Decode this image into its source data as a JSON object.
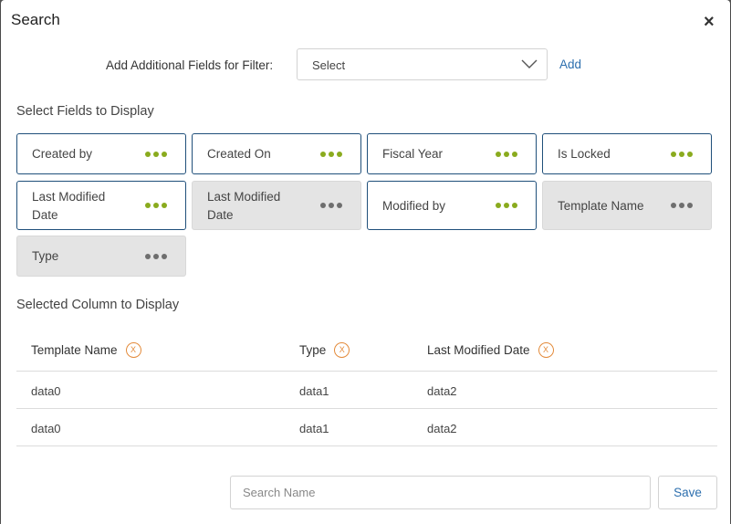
{
  "dialog": {
    "title": "Search",
    "close_icon": "×"
  },
  "filter": {
    "label": "Add Additional Fields for Filter:",
    "select_value": "Select",
    "add_label": "Add"
  },
  "fields_section": {
    "title": "Select Fields to Display"
  },
  "fields": [
    {
      "label": "Created by",
      "state": "active"
    },
    {
      "label": "Created On",
      "state": "active"
    },
    {
      "label": "Fiscal Year",
      "state": "active"
    },
    {
      "label": "Is Locked",
      "state": "active"
    },
    {
      "label": "Last Modified Date",
      "state": "active"
    },
    {
      "label": "Last Modified Date",
      "state": "inactive"
    },
    {
      "label": "Modified by",
      "state": "active"
    },
    {
      "label": "Template Name",
      "state": "inactive"
    },
    {
      "label": "Type",
      "state": "inactive"
    }
  ],
  "selected_section": {
    "title": "Selected Column to Display"
  },
  "columns": [
    {
      "label": "Template Name",
      "remove": "X"
    },
    {
      "label": "Type",
      "remove": "X"
    },
    {
      "label": "Last Modified Date",
      "remove": "X"
    }
  ],
  "rows": [
    [
      "data0",
      "data1",
      "data2"
    ],
    [
      "data0",
      "data1",
      "data2"
    ]
  ],
  "footer": {
    "search_placeholder": "Search Name",
    "save_label": "Save"
  },
  "colors": {
    "active_border": "#1f4f7a",
    "active_dots": "#8aab1e",
    "inactive_bg": "#e4e4e4",
    "link": "#2d6fae",
    "remove_badge": "#e38a3a"
  }
}
